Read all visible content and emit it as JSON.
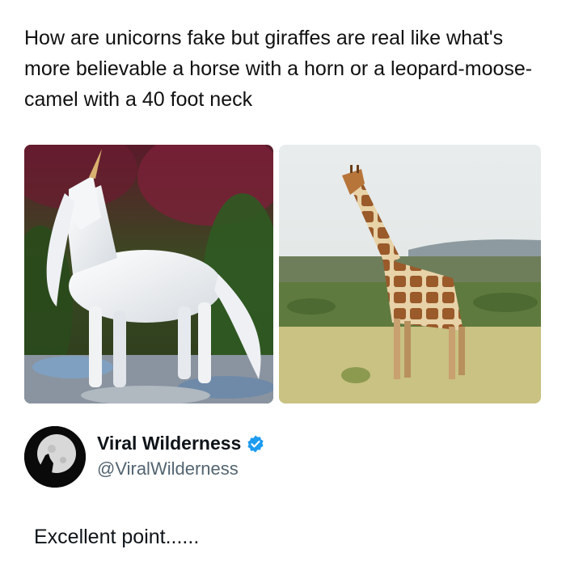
{
  "quoted_post": {
    "text": "How are unicorns fake but giraffes are real like what's more believable a horse with a horn or a leopard-moose-camel with a 40 foot neck",
    "media": [
      {
        "subject": "unicorn-photo"
      },
      {
        "subject": "giraffe-photo"
      }
    ]
  },
  "author": {
    "display_name": "Viral Wilderness",
    "handle": "@ViralWilderness",
    "verified": true,
    "avatar_icon": "howling-wolf-moon-icon",
    "verified_color": "#1d9bf0"
  },
  "reply": {
    "text": "Excellent point......"
  }
}
